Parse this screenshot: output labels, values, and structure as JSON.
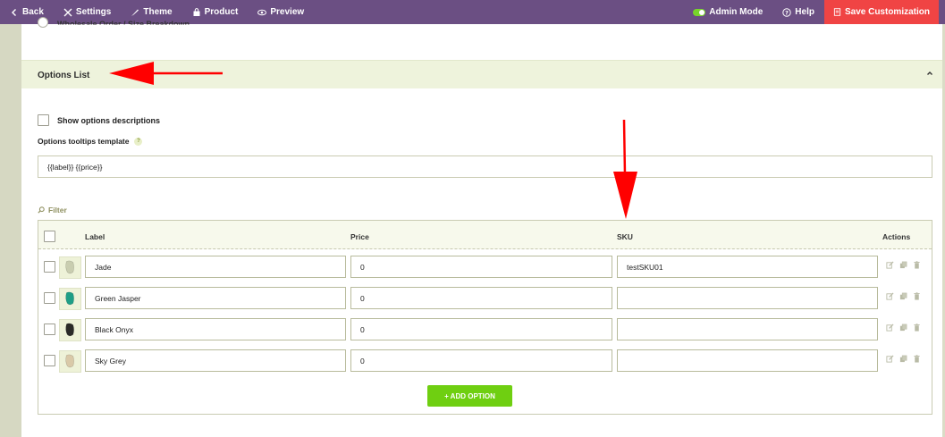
{
  "topbar": {
    "back": "Back",
    "settings": "Settings",
    "theme": "Theme",
    "product": "Product",
    "preview": "Preview",
    "admin_mode": "Admin Mode",
    "help": "Help",
    "save": "Save Customization"
  },
  "partial_option": {
    "label": "Wholesale Order / Size Breakdown"
  },
  "section": {
    "title": "Options List"
  },
  "options": {
    "show_descriptions_label": "Show options descriptions",
    "tooltips_label": "Options tooltips template",
    "tooltips_help": "?",
    "tooltips_value": "{{label}} {{price}}"
  },
  "filter": {
    "label": "Filter"
  },
  "table": {
    "headers": {
      "label": "Label",
      "price": "Price",
      "sku": "SKU",
      "actions": "Actions"
    },
    "rows": [
      {
        "label": "Jade",
        "price": "0",
        "sku": "testSKU01",
        "swatch": "#c9cdb0"
      },
      {
        "label": "Green Jasper",
        "price": "0",
        "sku": "",
        "swatch": "#1f9e86"
      },
      {
        "label": "Black Onyx",
        "price": "0",
        "sku": "",
        "swatch": "#2b2b28"
      },
      {
        "label": "Sky Grey",
        "price": "0",
        "sku": "",
        "swatch": "#d9c9a8"
      }
    ],
    "add_button": "+ ADD OPTION"
  },
  "colors": {
    "topbar": "#6b4f83",
    "save": "#f04444",
    "add": "#6fcf11",
    "annotation_arrow": "#ff0000"
  }
}
